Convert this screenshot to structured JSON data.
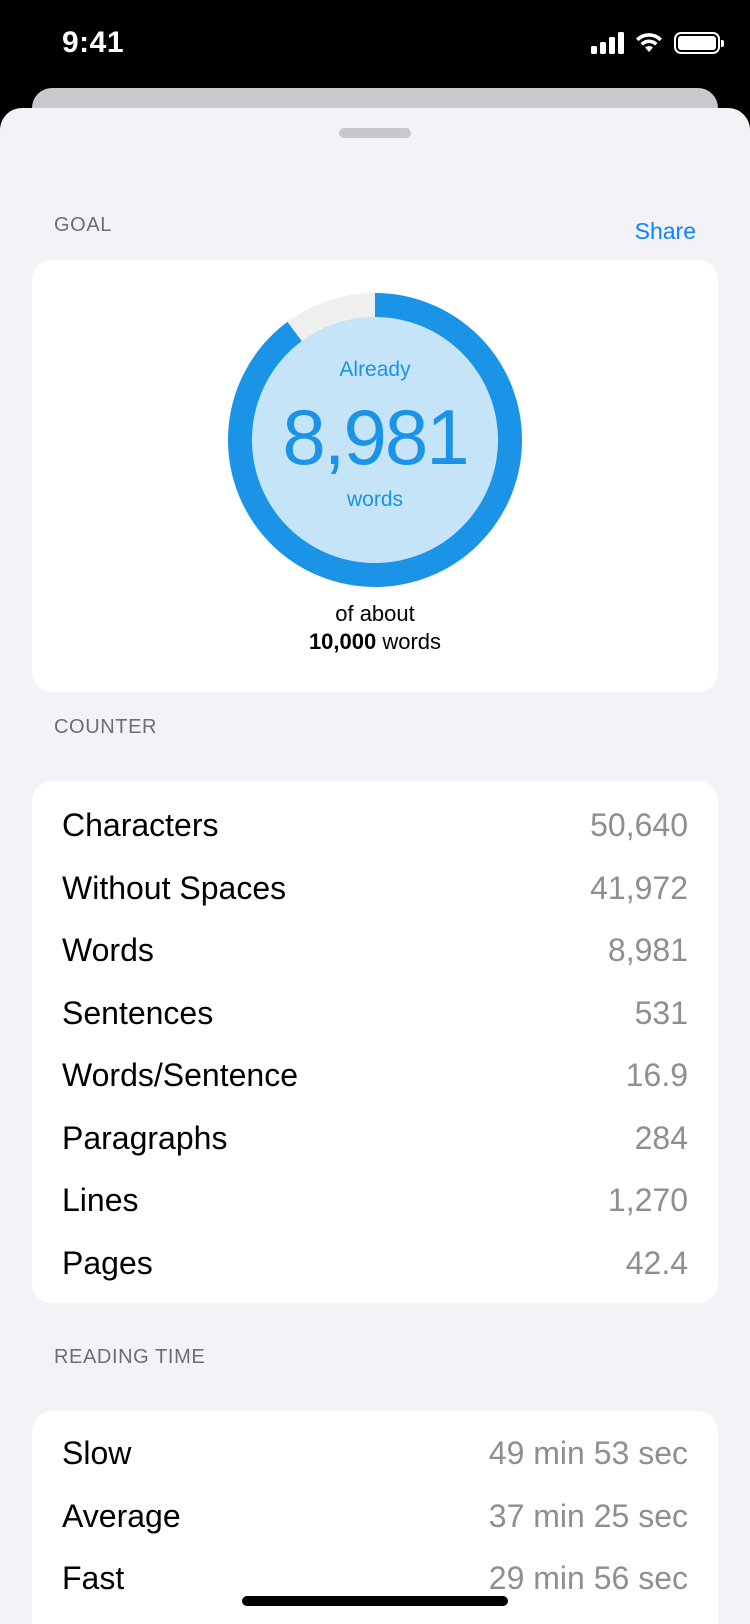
{
  "status_bar": {
    "time": "9:41",
    "icons": [
      "signal-icon",
      "wifi-icon",
      "battery-icon"
    ]
  },
  "goal": {
    "section_title": "GOAL",
    "share_label": "Share",
    "already_label": "Already",
    "word_count": "8,981",
    "words_label": "words",
    "caption_prefix": "of about",
    "goal_value": "10,000",
    "goal_suffix": "words",
    "progress_fraction": 0.8981,
    "accent_color": "#1b93e6",
    "ring_bg_color": "#c5e4f7"
  },
  "counter": {
    "section_title": "COUNTER",
    "rows": [
      {
        "label": "Characters",
        "value": "50,640"
      },
      {
        "label": "Without Spaces",
        "value": "41,972"
      },
      {
        "label": "Words",
        "value": "8,981"
      },
      {
        "label": "Sentences",
        "value": "531"
      },
      {
        "label": "Words/Sentence",
        "value": "16.9"
      },
      {
        "label": "Paragraphs",
        "value": "284"
      },
      {
        "label": "Lines",
        "value": "1,270"
      },
      {
        "label": "Pages",
        "value": "42.4"
      }
    ]
  },
  "reading_time": {
    "section_title": "READING TIME",
    "rows": [
      {
        "label": "Slow",
        "value": "49 min 53 sec"
      },
      {
        "label": "Average",
        "value": "37 min 25 sec"
      },
      {
        "label": "Fast",
        "value": "29 min 56 sec"
      }
    ]
  }
}
